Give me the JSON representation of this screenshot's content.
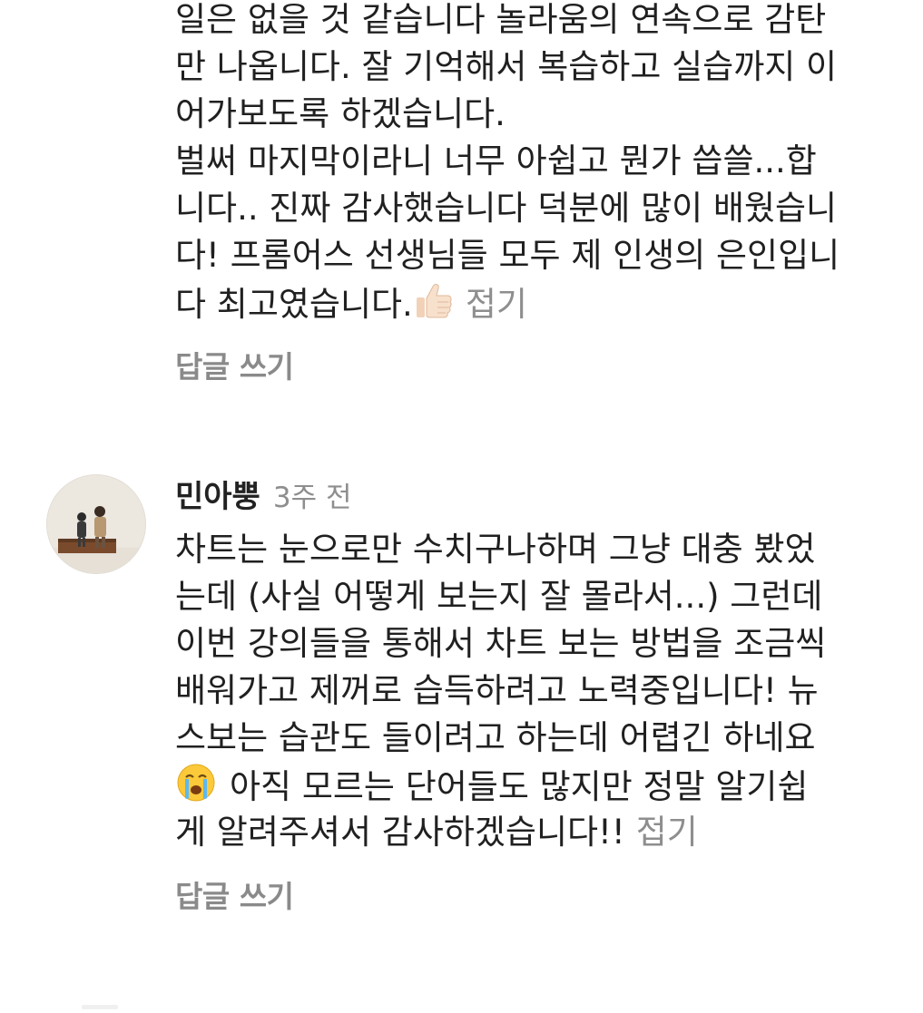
{
  "comment1": {
    "lines": [
      "일은 없을 것 같습니다 놀라움의 연속으로 감탄",
      "만 나옵니다. 잘 기억해서 복습하고 실습까지 이",
      "어가보도록 하겠습니다.",
      "벌써 마지막이라니 너무 아쉽고 뭔가 씁쓸...합",
      "니다.. 진짜 감사했습니다 덕분에 많이 배웠습니",
      "다! 프롬어스 선생님들 모두 제 인생의 은인입니",
      "다 최고였습니다."
    ],
    "emoji": "thumbs-up-icon",
    "collapse_label": "접기",
    "reply_label": "답글 쓰기"
  },
  "comment2": {
    "author": "민아뿡",
    "time": "3주 전",
    "lines": [
      "차트는 눈으로만 수치구나하며 그냥 대충 봤었",
      "는데 (사실 어떻게 보는지 잘 몰라서...) 그런데",
      "이번 강의들을 통해서 차트 보는 방법을 조금씩",
      "배워가고 제꺼로 습득하려고 노력중입니다! 뉴",
      "스보는 습관도 들이려고 하는데 어렵긴 하네요",
      "아직 모르는 단어들도 많지만 정말 알기쉽",
      "게 알려주셔서 감사하겠습니다!!"
    ],
    "emoji": "crying-face-icon",
    "collapse_label": "접기",
    "reply_label": "답글 쓰기"
  },
  "colors": {
    "text": "#202020",
    "muted": "#8e8e8e",
    "reply": "#8a8a8a"
  }
}
